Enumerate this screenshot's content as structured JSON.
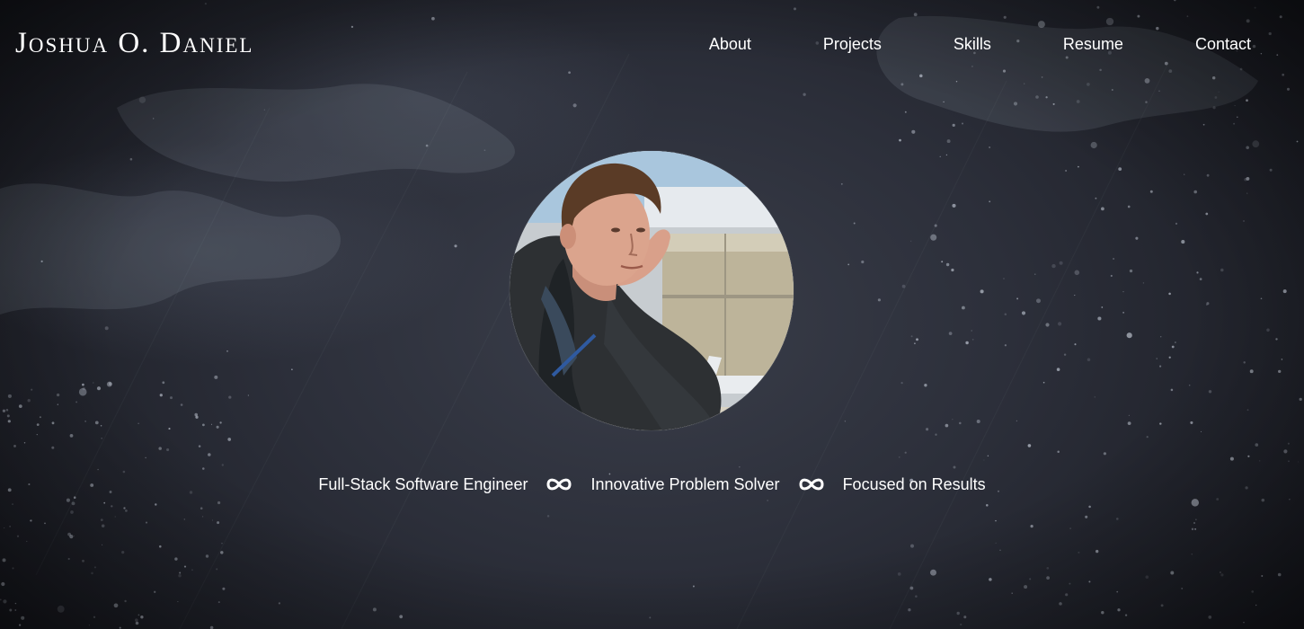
{
  "header": {
    "brand": "Joshua O. Daniel",
    "nav": [
      {
        "label": "About"
      },
      {
        "label": "Projects"
      },
      {
        "label": "Skills"
      },
      {
        "label": "Resume"
      },
      {
        "label": "Contact"
      }
    ]
  },
  "hero": {
    "avatar_icon": "profile-photo",
    "taglines": [
      "Full-Stack Software Engineer",
      "Innovative Problem Solver",
      "Focused on Results"
    ],
    "separator_icon": "infinity-icon"
  },
  "colors": {
    "background": "#2c2f3a",
    "text": "#ffffff"
  }
}
